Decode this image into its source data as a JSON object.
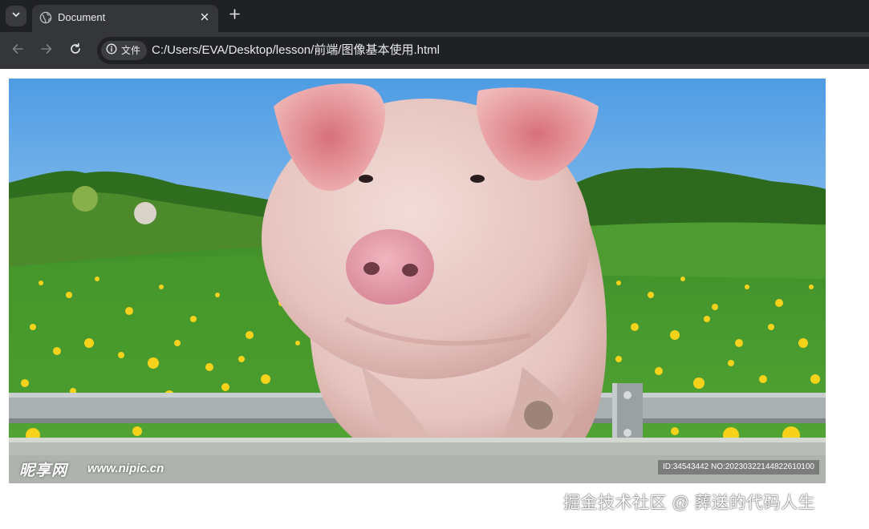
{
  "browser": {
    "tab": {
      "title": "Document",
      "favicon": "globe-icon"
    },
    "tab_search_icon": "chevron-down-icon",
    "new_tab_icon": "plus-icon",
    "close_tab_icon": "close-icon",
    "toolbar": {
      "back_icon": "arrow-left-icon",
      "forward_icon": "arrow-right-icon",
      "reload_icon": "reload-icon"
    },
    "omnibox": {
      "site_info_icon": "info-icon",
      "site_info_label": "文件",
      "url": "C:/Users/EVA/Desktop/lesson/前端/图像基本使用.html"
    }
  },
  "page": {
    "image": {
      "logo_text": "昵享网",
      "logo_url": "www.nipic.cn",
      "id_text": "ID:34543442 NO:20230322144822610100"
    }
  },
  "watermark": "掘金技术社区 @ 葬送的代码人生",
  "colors": {
    "tabbar_bg": "#202124",
    "toolbar_bg": "#35363a",
    "omnibox_bg": "#202124",
    "sky": "#6aaee8",
    "grass": "#3f9a2c",
    "pig": "#e9c9c4",
    "snout": "#e8a0ac",
    "dandelion": "#f7d51a",
    "rail": "#a7adae"
  }
}
